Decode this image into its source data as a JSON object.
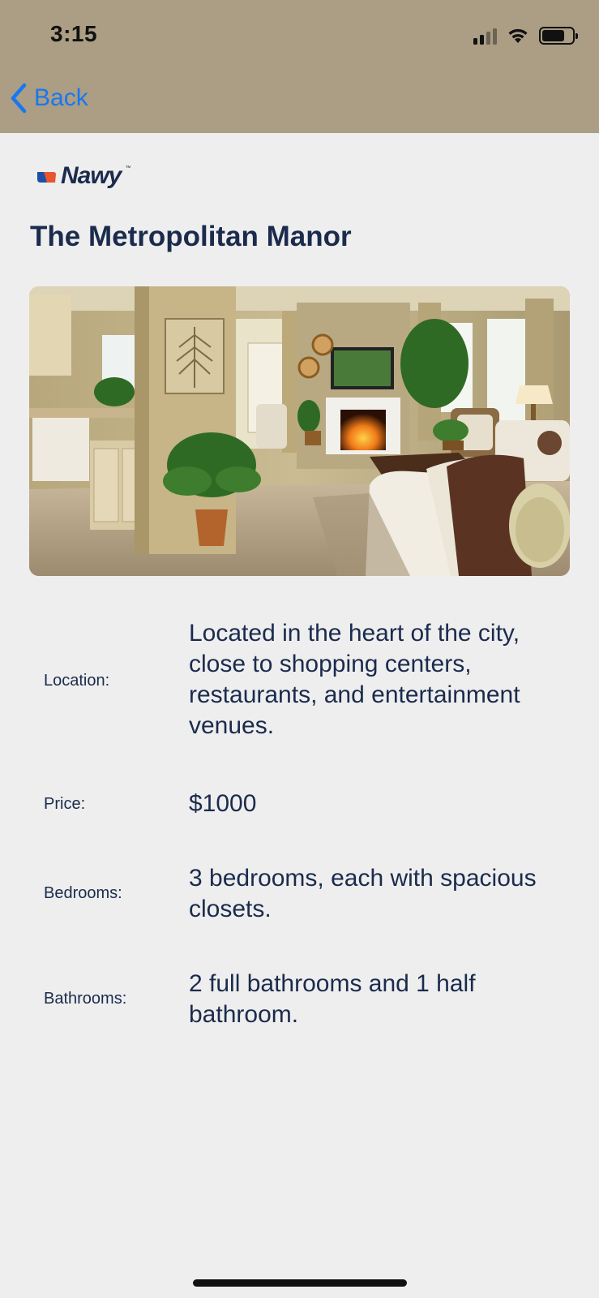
{
  "status_bar": {
    "time": "3:15",
    "battery_level": 0.75,
    "signal_bars": 2
  },
  "nav": {
    "back_label": "Back",
    "accent_color": "#1877f2"
  },
  "brand": {
    "logo_text": "Nawy",
    "logo_tm": "™"
  },
  "listing": {
    "title": "The Metropolitan Manor",
    "details": [
      {
        "label": "Location:",
        "value": "Located in the heart of the city, close to shopping centers, restaurants, and entertainment venues."
      },
      {
        "label": "Price:",
        "value": "$1000"
      },
      {
        "label": "Bedrooms:",
        "value": "3 bedrooms, each with spacious closets."
      },
      {
        "label": "Bathrooms:",
        "value": "2 full bathrooms and 1 half bathroom."
      }
    ]
  },
  "colors": {
    "header_bg": "#ab9e84",
    "page_bg": "#eeeeee",
    "text_primary": "#1b2b4d"
  }
}
